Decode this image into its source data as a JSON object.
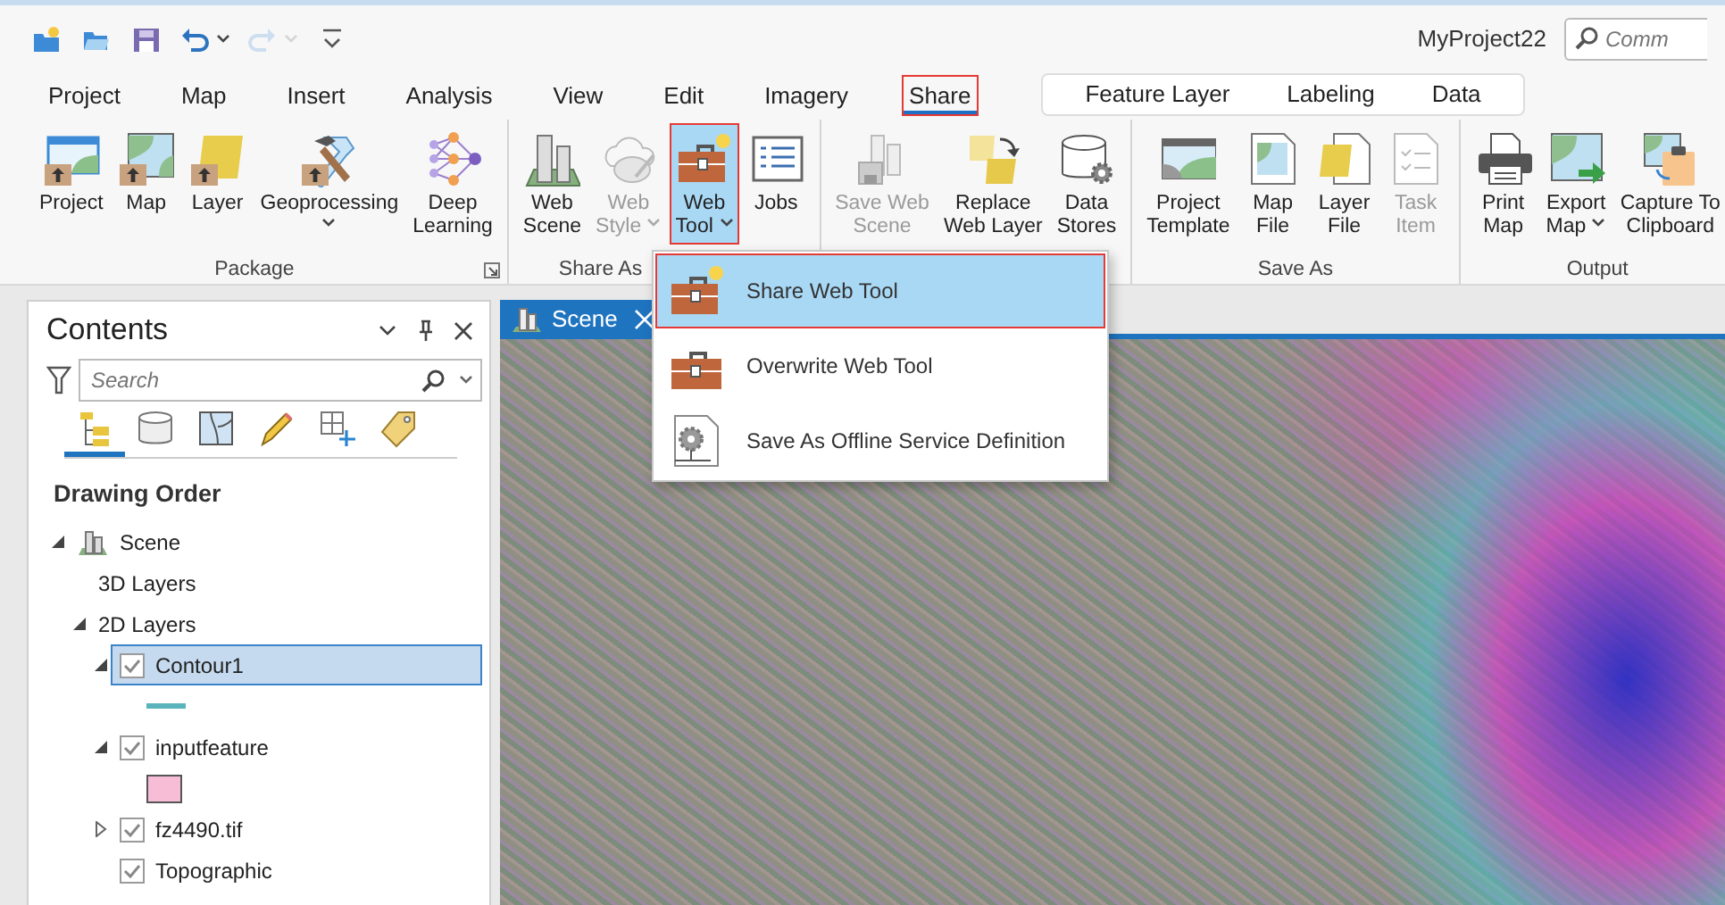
{
  "window": {
    "title": "MyProject22",
    "command_search": {
      "placeholder": "Comm"
    }
  },
  "quick_access": [
    {
      "disabled": false,
      "dropdown": false
    },
    {
      "disabled": false,
      "dropdown": false
    },
    {
      "disabled": false,
      "dropdown": false
    },
    {
      "disabled": false,
      "dropdown": true
    },
    {
      "disabled": true,
      "dropdown": true
    },
    {
      "disabled": false,
      "dropdown": false
    }
  ],
  "ribbon_tabs": [
    {
      "label": "Project",
      "selected": false,
      "highlighted": false
    },
    {
      "label": "Map",
      "selected": false,
      "highlighted": false
    },
    {
      "label": "Insert",
      "selected": false,
      "highlighted": false
    },
    {
      "label": "Analysis",
      "selected": false,
      "highlighted": false
    },
    {
      "label": "View",
      "selected": false,
      "highlighted": false
    },
    {
      "label": "Edit",
      "selected": false,
      "highlighted": false
    },
    {
      "label": "Imagery",
      "selected": false,
      "highlighted": false
    },
    {
      "label": "Share",
      "selected": true,
      "highlighted": true
    }
  ],
  "contextual_tabs": [
    {
      "label": "Feature Layer",
      "selected": false
    },
    {
      "label": "Labeling",
      "selected": false
    },
    {
      "label": "Data",
      "selected": false
    }
  ],
  "ribbon_groups": [
    {
      "label": "Package",
      "launcher": true,
      "buttons": [
        {
          "lines": [
            "Project"
          ],
          "disabled": false,
          "dropdown": false,
          "active": false,
          "highlighted": false
        },
        {
          "lines": [
            "Map"
          ],
          "disabled": false,
          "dropdown": false,
          "active": false,
          "highlighted": false
        },
        {
          "lines": [
            "Layer"
          ],
          "disabled": false,
          "dropdown": false,
          "active": false,
          "highlighted": false
        },
        {
          "lines": [
            "Geoprocessing"
          ],
          "disabled": false,
          "dropdown": true,
          "active": false,
          "highlighted": false
        },
        {
          "lines": [
            "Deep",
            "Learning"
          ],
          "disabled": false,
          "dropdown": false,
          "active": false,
          "highlighted": false
        }
      ]
    },
    {
      "label": "Share As",
      "launcher": false,
      "buttons": [
        {
          "lines": [
            "Web",
            "Scene"
          ],
          "disabled": false,
          "dropdown": false,
          "active": false,
          "highlighted": false
        },
        {
          "lines": [
            "Web",
            "Style"
          ],
          "disabled": true,
          "dropdown": true,
          "active": false,
          "highlighted": false
        },
        {
          "lines": [
            "Web",
            "Tool"
          ],
          "disabled": false,
          "dropdown": true,
          "active": true,
          "highlighted": true
        },
        {
          "lines": [
            "Jobs"
          ],
          "disabled": false,
          "dropdown": false,
          "active": false,
          "highlighted": false
        }
      ]
    },
    {
      "launcher": false,
      "buttons": [
        {
          "lines": [
            "Save Web",
            "Scene"
          ],
          "disabled": true,
          "dropdown": false,
          "active": false,
          "highlighted": false
        },
        {
          "lines": [
            "Replace",
            "Web Layer"
          ],
          "disabled": false,
          "dropdown": false,
          "active": false,
          "highlighted": false
        },
        {
          "lines": [
            "Data",
            "Stores"
          ],
          "disabled": false,
          "dropdown": false,
          "active": false,
          "highlighted": false
        }
      ]
    },
    {
      "label": "Save As",
      "launcher": false,
      "buttons": [
        {
          "lines": [
            "Project",
            "Template"
          ],
          "disabled": false,
          "dropdown": false,
          "active": false,
          "highlighted": false
        },
        {
          "lines": [
            "Map",
            "File"
          ],
          "disabled": false,
          "dropdown": false,
          "active": false,
          "highlighted": false
        },
        {
          "lines": [
            "Layer",
            "File"
          ],
          "disabled": false,
          "dropdown": false,
          "active": false,
          "highlighted": false
        },
        {
          "lines": [
            "Task",
            "Item"
          ],
          "disabled": true,
          "dropdown": false,
          "active": false,
          "highlighted": false
        }
      ]
    },
    {
      "label": "Output",
      "launcher": false,
      "buttons": [
        {
          "lines": [
            "Print",
            "Map"
          ],
          "disabled": false,
          "dropdown": false,
          "active": false,
          "highlighted": false
        },
        {
          "lines": [
            "Export",
            "Map"
          ],
          "disabled": false,
          "dropdown": true,
          "active": false,
          "highlighted": false
        },
        {
          "lines": [
            "Capture To",
            "Clipboard"
          ],
          "disabled": false,
          "dropdown": false,
          "active": false,
          "highlighted": false
        }
      ]
    }
  ],
  "contents": {
    "title": "Contents",
    "search": {
      "placeholder": "Search"
    },
    "view_tabs": [
      {
        "selected": true
      },
      {
        "selected": false
      },
      {
        "selected": false
      },
      {
        "selected": false
      },
      {
        "selected": false
      },
      {
        "selected": false
      }
    ],
    "heading": "Drawing Order",
    "tree": [
      {
        "label": "Scene",
        "expanded": true,
        "selected": false,
        "children": [
          {
            "label": "3D Layers",
            "selected": false
          },
          {
            "label": "2D Layers",
            "expanded": true,
            "selected": false,
            "children": [
              {
                "label": "Contour1",
                "expanded": true,
                "checked": true,
                "selected": true,
                "symbol": {
                  "kind": "line",
                  "color": "#5ab4bc"
                }
              },
              {
                "label": "inputfeature",
                "expanded": true,
                "checked": true,
                "selected": false,
                "symbol": {
                  "kind": "fill",
                  "color": "#f7bcd6"
                }
              },
              {
                "label": "fz4490.tif",
                "expanded": false,
                "checked": true,
                "selected": false
              },
              {
                "label": "Topographic",
                "checked": true,
                "selected": false
              }
            ]
          }
        ]
      }
    ]
  },
  "map_view": {
    "tabs": [
      {
        "label": "Scene",
        "selected": true
      }
    ]
  },
  "dropdown_menu": {
    "items": [
      {
        "label": "Share Web Tool",
        "selected": true,
        "highlighted": true
      },
      {
        "label": "Overwrite Web Tool",
        "selected": false,
        "highlighted": false
      },
      {
        "label": "Save As Offline Service Definition",
        "selected": false,
        "highlighted": false
      }
    ]
  }
}
